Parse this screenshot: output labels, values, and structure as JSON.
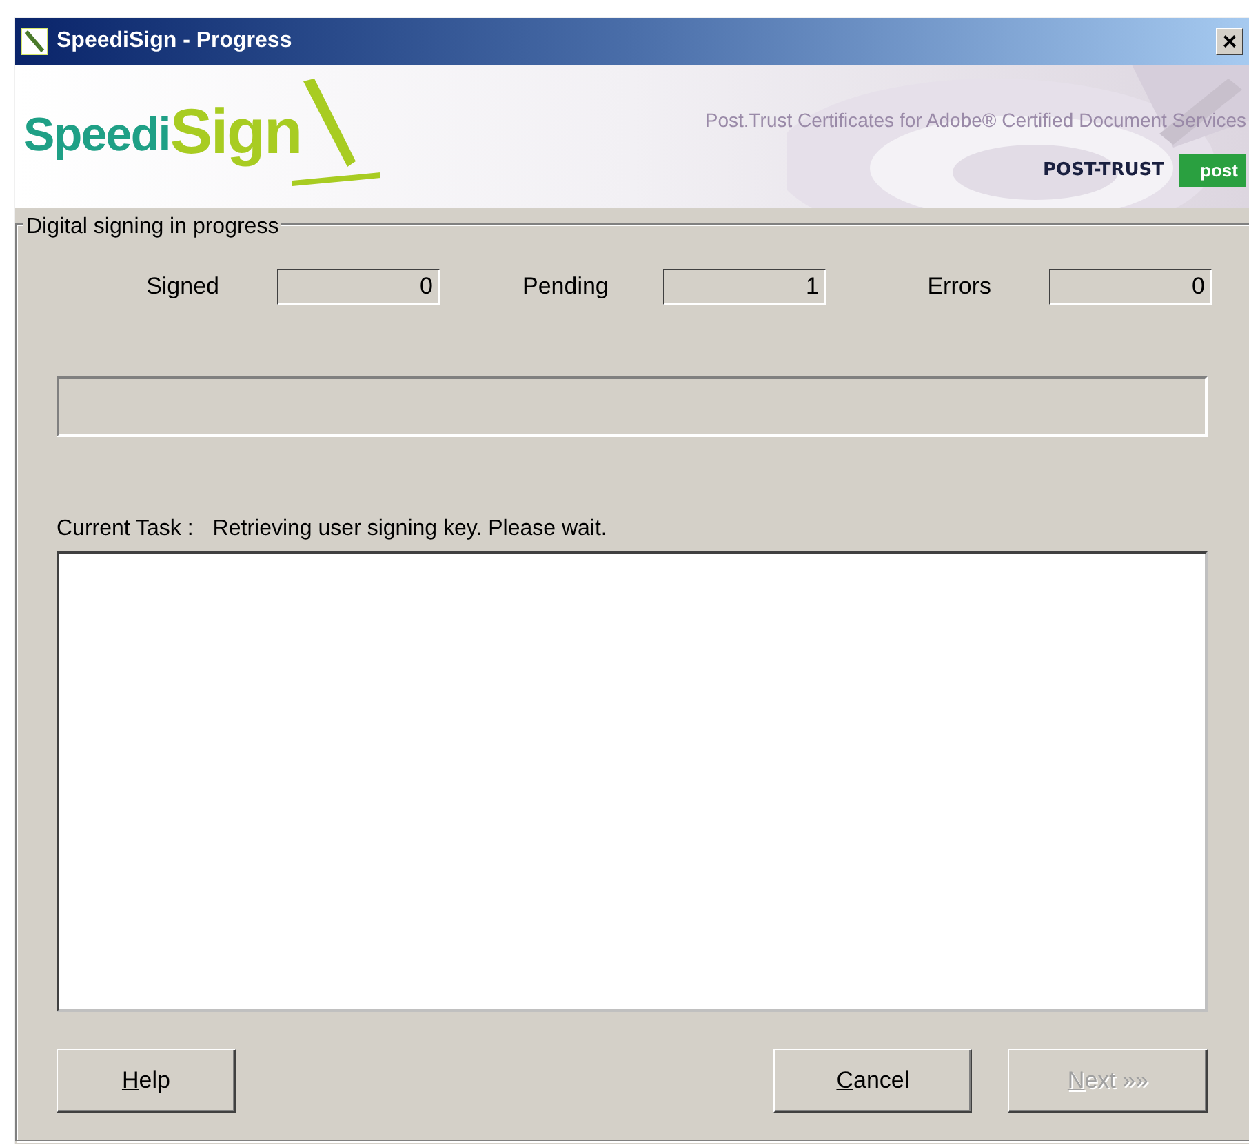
{
  "window": {
    "title": "SpeediSign - Progress",
    "close": "×"
  },
  "banner": {
    "logo_first": "Speedi",
    "logo_second": "Sign",
    "tagline": "Post.Trust Certificates for Adobe® Certified Document Services",
    "partner_logo": "POST-TRUST",
    "post_logo": "post"
  },
  "group": {
    "title": "Digital signing in progress"
  },
  "counters": [
    {
      "label": "Signed",
      "value": "0"
    },
    {
      "label": "Pending",
      "value": "1"
    },
    {
      "label": "Errors",
      "value": "0"
    }
  ],
  "progress": {
    "level": 0
  },
  "current_task": {
    "label": "Current Task :",
    "value": "Retrieving user signing key. Please wait."
  },
  "buttons": [
    {
      "accel": "H",
      "rest": "elp",
      "disabled": false
    },
    {
      "accel": "C",
      "rest": "ancel",
      "disabled": false
    },
    {
      "accel": "N",
      "rest": "ext »»",
      "disabled": true
    }
  ]
}
